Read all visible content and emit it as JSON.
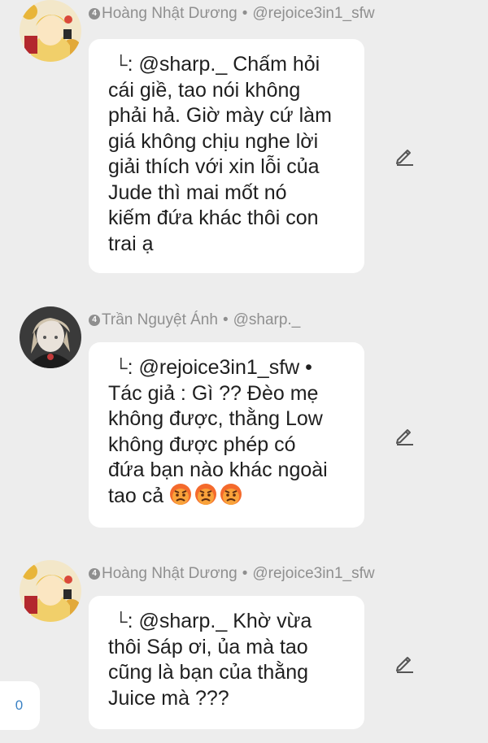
{
  "comments": [
    {
      "level": "4",
      "author": "Hoàng Nhật Dương",
      "separator": "•",
      "handle": "@rejoice3in1_sfw",
      "reply_icon": "reply-corner-icon",
      "reply_to": "@sharp._",
      "text_lines": [
        "Chấm hỏi",
        "cái giề, tao nói không",
        "phải hả. Giờ mày cứ làm",
        "giá không chịu nghe lời",
        "giải thích với xin lỗi của",
        "Jude thì mai mốt nó",
        "kiếm đứa khác thôi con",
        "trai ạ"
      ]
    },
    {
      "level": "4",
      "author": "Trần Nguyệt Ánh",
      "separator": "•",
      "handle": "@sharp._",
      "reply_icon": "reply-corner-icon",
      "reply_to": "@rejoice3in1_sfw •",
      "text_lines": [
        "Tác giả :  Gì ?? Đèo mẹ",
        "không được, thằng Low",
        "không được phép có",
        "đứa bạn nào khác ngoài",
        "tao cả"
      ],
      "emojis": [
        "angry-face",
        "angry-face",
        "angry-face"
      ]
    },
    {
      "level": "4",
      "author": "Hoàng Nhật Dương",
      "separator": "•",
      "handle": "@rejoice3in1_sfw",
      "reply_icon": "reply-corner-icon",
      "reply_to": "@sharp._",
      "text_lines": [
        "Khờ vừa",
        "thôi Sáp ơi, ủa mà tao",
        "cũng là bạn của thằng",
        "Juice mà ???"
      ]
    }
  ],
  "side_counter": {
    "value": "0"
  },
  "colors": {
    "background": "#ededed",
    "bubble": "#ffffff",
    "meta_text": "#8f8f8f",
    "body_text": "#1f1f1f",
    "counter_text": "#3b82c4"
  }
}
